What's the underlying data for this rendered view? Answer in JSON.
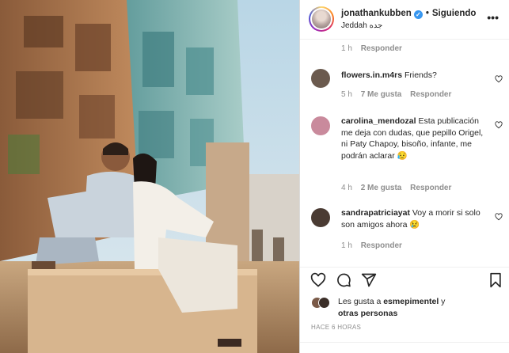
{
  "post": {
    "username": "jonathankubben",
    "separator": "•",
    "follow_status": "Siguiendo",
    "location": "Jeddah جده",
    "more_label": "•••",
    "verified_mark": "✓"
  },
  "previous_comment_meta": {
    "time": "1 h",
    "reply": "Responder"
  },
  "comments": [
    {
      "username": "flowers.in.m4rs",
      "text": " Friends?",
      "time": "5 h",
      "likes": "7 Me gusta",
      "reply": "Responder",
      "avatar_color": "#6b5a4e"
    },
    {
      "username": "carolina_mendozal",
      "text": " Esta publicación me deja con dudas, que pepillo Origel, ni Paty Chapoy, bisoño, infante, me podrán aclarar 😥",
      "time": "4 h",
      "likes": "2 Me gusta",
      "reply": "Responder",
      "avatar_color": "#c98a9c"
    },
    {
      "username": "sandrapatriciayat",
      "text": " Voy a morir si solo son amigos ahora 😢",
      "time": "1 h",
      "likes": "",
      "reply": "Responder",
      "avatar_color": "#4a3b33"
    }
  ],
  "likes_summary": {
    "prefix": "Les gusta a ",
    "user": "esmepimentel",
    "middle": " y",
    "others": "otras personas"
  },
  "timestamp": "HACE 6 HORAS",
  "colors": {
    "verified": "#3897f0",
    "muted": "#8e8e8e",
    "text": "#262626",
    "border": "#dbdbdb"
  },
  "icons": [
    "heart-icon",
    "comment-icon",
    "share-icon",
    "bookmark-icon",
    "more-icon",
    "verified-icon"
  ]
}
